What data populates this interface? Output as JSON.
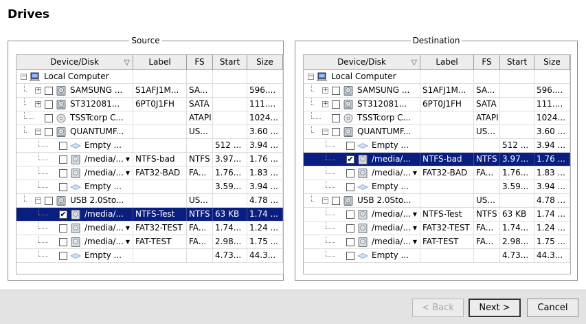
{
  "page_title": "Drives",
  "columns": [
    "Device/Disk",
    "Label",
    "FS",
    "Start",
    "Size"
  ],
  "source": {
    "title": "Source",
    "rows": [
      {
        "depth": 0,
        "expander": "minus",
        "checkbox": false,
        "checked": false,
        "icon": "computer-icon",
        "device": "Local Computer",
        "label": "",
        "fs": "",
        "start": "",
        "size": "",
        "selected": false,
        "dropdown": false
      },
      {
        "depth": 1,
        "expander": "plus",
        "checkbox": true,
        "checked": false,
        "icon": "disk-icon",
        "device": "SAMSUNG ...",
        "label": "S1AFJ1M...",
        "fs": "SA...",
        "start": "",
        "size": "596....",
        "selected": false,
        "dropdown": false
      },
      {
        "depth": 1,
        "expander": "plus",
        "checkbox": true,
        "checked": false,
        "icon": "disk-icon",
        "device": "ST312081...",
        "label": "6PT0J1FH",
        "fs": "SATA",
        "start": "",
        "size": "111....",
        "selected": false,
        "dropdown": false
      },
      {
        "depth": 1,
        "expander": "none",
        "checkbox": true,
        "checked": false,
        "icon": "cdrom-icon",
        "device": "TSSTcorp C...",
        "label": "",
        "fs": "ATAPI",
        "start": "",
        "size": "1024...",
        "selected": false,
        "dropdown": false
      },
      {
        "depth": 1,
        "expander": "minus",
        "checkbox": true,
        "checked": false,
        "icon": "disk-icon",
        "device": "QUANTUMF...",
        "label": "",
        "fs": "US...",
        "start": "",
        "size": "3.60 ...",
        "selected": false,
        "dropdown": false
      },
      {
        "depth": 2,
        "expander": "none",
        "checkbox": true,
        "checked": false,
        "icon": "empty-space-icon",
        "device": "Empty ...",
        "label": "",
        "fs": "",
        "start": "512 ...",
        "size": "3.94 ...",
        "selected": false,
        "dropdown": false
      },
      {
        "depth": 2,
        "expander": "none",
        "checkbox": true,
        "checked": false,
        "icon": "partition-icon",
        "device": "/media/...",
        "label": "NTFS-bad",
        "fs": "NTFS",
        "start": "3.97...",
        "size": "1.76 ...",
        "selected": false,
        "dropdown": true
      },
      {
        "depth": 2,
        "expander": "none",
        "checkbox": true,
        "checked": false,
        "icon": "partition-icon",
        "device": "/media/...",
        "label": "FAT32-BAD",
        "fs": "FA...",
        "start": "1.76...",
        "size": "1.83 ...",
        "selected": false,
        "dropdown": true
      },
      {
        "depth": 2,
        "expander": "none",
        "checkbox": true,
        "checked": false,
        "icon": "empty-space-icon",
        "device": "Empty ...",
        "label": "",
        "fs": "",
        "start": "3.59...",
        "size": "3.94 ...",
        "selected": false,
        "dropdown": false
      },
      {
        "depth": 1,
        "expander": "minus",
        "checkbox": true,
        "checked": false,
        "icon": "disk-icon",
        "device": "USB 2.0Sto...",
        "label": "",
        "fs": "US...",
        "start": "",
        "size": "4.78 ...",
        "selected": false,
        "dropdown": false
      },
      {
        "depth": 2,
        "expander": "none",
        "checkbox": true,
        "checked": true,
        "icon": "partition-icon",
        "device": "/media/...",
        "label": "NTFS-Test",
        "fs": "NTFS",
        "start": "63 KB",
        "size": "1.74 ...",
        "selected": true,
        "dropdown": false
      },
      {
        "depth": 2,
        "expander": "none",
        "checkbox": true,
        "checked": false,
        "icon": "partition-icon",
        "device": "/media/...",
        "label": "FAT32-TEST",
        "fs": "FA...",
        "start": "1.74...",
        "size": "1.24 ...",
        "selected": false,
        "dropdown": true
      },
      {
        "depth": 2,
        "expander": "none",
        "checkbox": true,
        "checked": false,
        "icon": "partition-icon",
        "device": "/media/...",
        "label": "FAT-TEST",
        "fs": "FA...",
        "start": "2.98...",
        "size": "1.75 ...",
        "selected": false,
        "dropdown": true
      },
      {
        "depth": 2,
        "expander": "none",
        "checkbox": true,
        "checked": false,
        "icon": "empty-space-icon",
        "device": "Empty ...",
        "label": "",
        "fs": "",
        "start": "4.73...",
        "size": "44.3...",
        "selected": false,
        "dropdown": false
      }
    ]
  },
  "destination": {
    "title": "Destination",
    "rows": [
      {
        "depth": 0,
        "expander": "minus",
        "checkbox": false,
        "checked": false,
        "icon": "computer-icon",
        "device": "Local Computer",
        "label": "",
        "fs": "",
        "start": "",
        "size": "",
        "selected": false,
        "dropdown": false
      },
      {
        "depth": 1,
        "expander": "plus",
        "checkbox": true,
        "checked": false,
        "icon": "disk-icon",
        "device": "SAMSUNG ...",
        "label": "S1AFJ1M...",
        "fs": "SA...",
        "start": "",
        "size": "596....",
        "selected": false,
        "dropdown": false
      },
      {
        "depth": 1,
        "expander": "plus",
        "checkbox": true,
        "checked": false,
        "icon": "disk-icon",
        "device": "ST312081...",
        "label": "6PT0J1FH",
        "fs": "SATA",
        "start": "",
        "size": "111....",
        "selected": false,
        "dropdown": false
      },
      {
        "depth": 1,
        "expander": "none",
        "checkbox": true,
        "checked": false,
        "icon": "cdrom-icon",
        "device": "TSSTcorp C...",
        "label": "",
        "fs": "ATAPI",
        "start": "",
        "size": "1024...",
        "selected": false,
        "dropdown": false
      },
      {
        "depth": 1,
        "expander": "minus",
        "checkbox": true,
        "checked": false,
        "icon": "disk-icon",
        "device": "QUANTUMF...",
        "label": "",
        "fs": "US...",
        "start": "",
        "size": "3.60 ...",
        "selected": false,
        "dropdown": false
      },
      {
        "depth": 2,
        "expander": "none",
        "checkbox": true,
        "checked": false,
        "icon": "empty-space-icon",
        "device": "Empty ...",
        "label": "",
        "fs": "",
        "start": "512 ...",
        "size": "3.94 ...",
        "selected": false,
        "dropdown": false
      },
      {
        "depth": 2,
        "expander": "none",
        "checkbox": true,
        "checked": true,
        "icon": "partition-icon",
        "device": "/media/...",
        "label": "NTFS-bad",
        "fs": "NTFS",
        "start": "3.97...",
        "size": "1.76 ...",
        "selected": true,
        "dropdown": false
      },
      {
        "depth": 2,
        "expander": "none",
        "checkbox": true,
        "checked": false,
        "icon": "partition-icon",
        "device": "/media/...",
        "label": "FAT32-BAD",
        "fs": "FA...",
        "start": "1.76...",
        "size": "1.83 ...",
        "selected": false,
        "dropdown": true
      },
      {
        "depth": 2,
        "expander": "none",
        "checkbox": true,
        "checked": false,
        "icon": "empty-space-icon",
        "device": "Empty ...",
        "label": "",
        "fs": "",
        "start": "3.59...",
        "size": "3.94 ...",
        "selected": false,
        "dropdown": false
      },
      {
        "depth": 1,
        "expander": "minus",
        "checkbox": true,
        "checked": false,
        "icon": "disk-icon",
        "device": "USB 2.0Sto...",
        "label": "",
        "fs": "US...",
        "start": "",
        "size": "4.78 ...",
        "selected": false,
        "dropdown": false
      },
      {
        "depth": 2,
        "expander": "none",
        "checkbox": true,
        "checked": false,
        "icon": "partition-icon",
        "device": "/media/...",
        "label": "NTFS-Test",
        "fs": "NTFS",
        "start": "63 KB",
        "size": "1.74 ...",
        "selected": false,
        "dropdown": true
      },
      {
        "depth": 2,
        "expander": "none",
        "checkbox": true,
        "checked": false,
        "icon": "partition-icon",
        "device": "/media/...",
        "label": "FAT32-TEST",
        "fs": "FA...",
        "start": "1.74...",
        "size": "1.24 ...",
        "selected": false,
        "dropdown": true
      },
      {
        "depth": 2,
        "expander": "none",
        "checkbox": true,
        "checked": false,
        "icon": "partition-icon",
        "device": "/media/...",
        "label": "FAT-TEST",
        "fs": "FA...",
        "start": "2.98...",
        "size": "1.75 ...",
        "selected": false,
        "dropdown": true
      },
      {
        "depth": 2,
        "expander": "none",
        "checkbox": true,
        "checked": false,
        "icon": "empty-space-icon",
        "device": "Empty ...",
        "label": "",
        "fs": "",
        "start": "4.73...",
        "size": "44.3...",
        "selected": false,
        "dropdown": false
      }
    ]
  },
  "buttons": {
    "back": "< Back",
    "next": "Next >",
    "cancel": "Cancel"
  },
  "colors": {
    "selection": "#0a1e80"
  }
}
